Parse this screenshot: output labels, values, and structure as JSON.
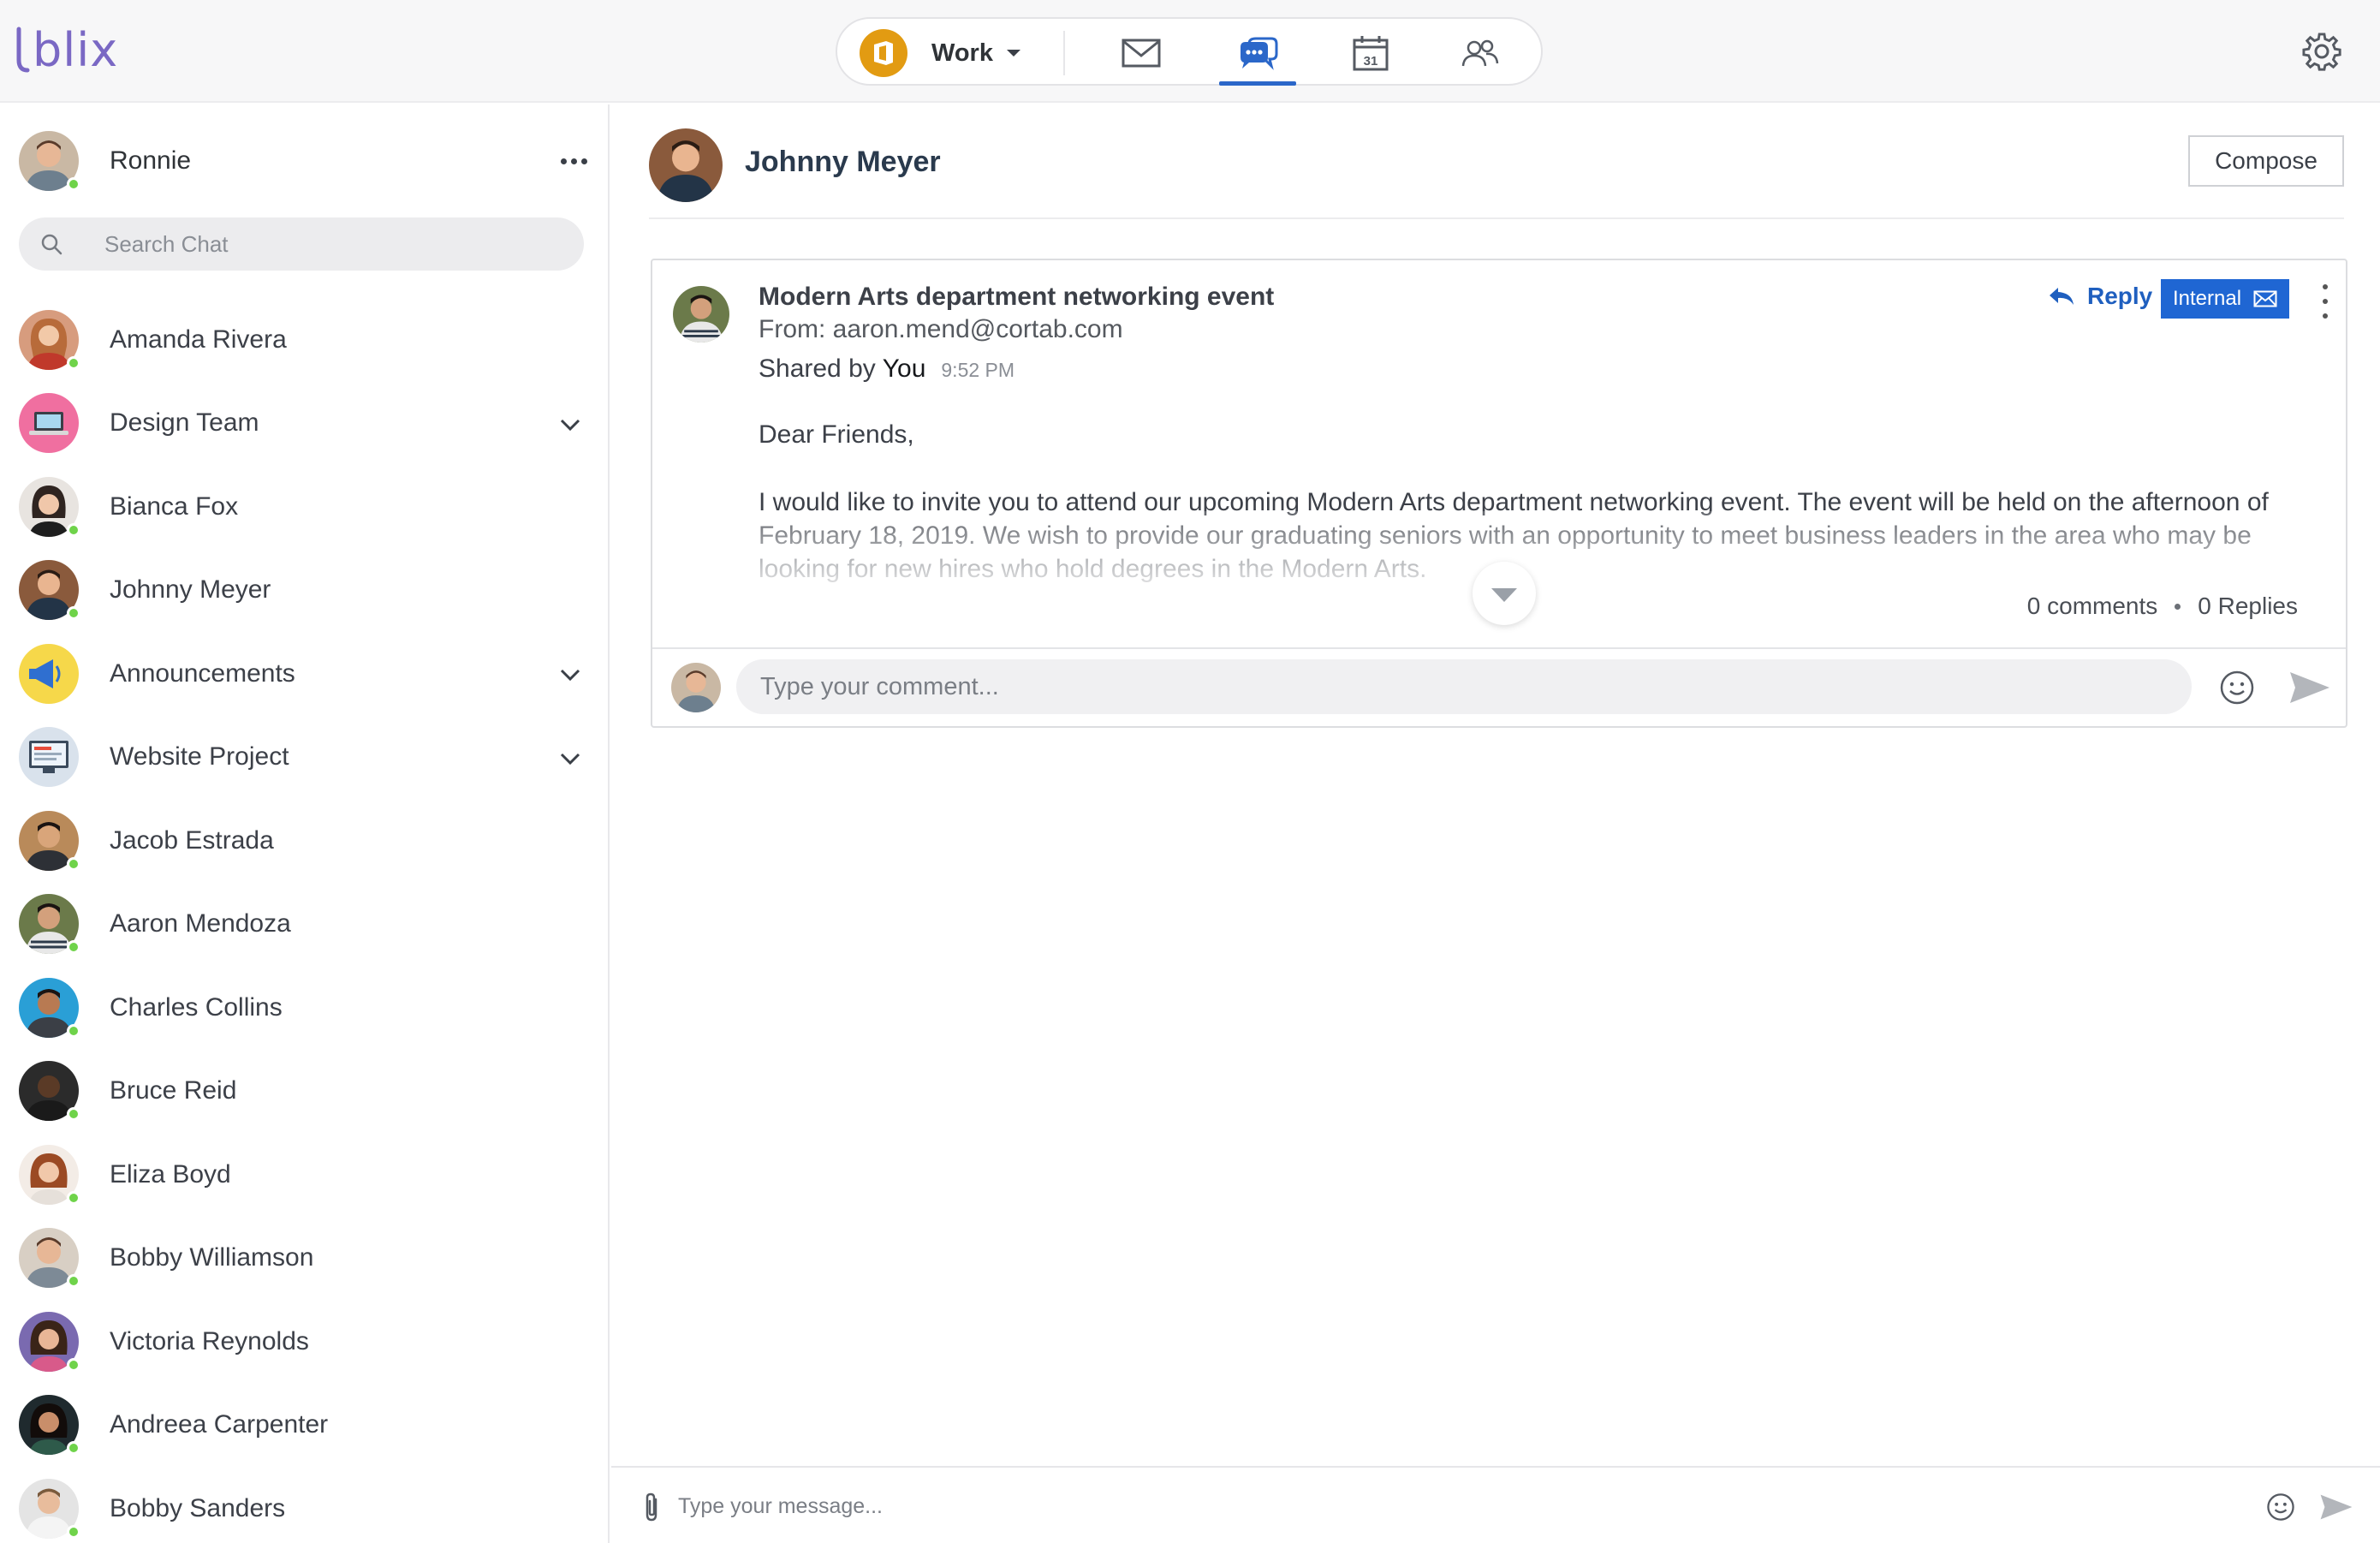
{
  "app": {
    "logo_text": "blix"
  },
  "topbar": {
    "account_label": "Work",
    "account_icon": "office-icon",
    "tabs": [
      {
        "name": "mail",
        "icon": "mail-icon",
        "active": false
      },
      {
        "name": "chat",
        "icon": "chat-icon",
        "active": true
      },
      {
        "name": "calendar",
        "icon": "calendar-icon",
        "day": "31",
        "active": false
      },
      {
        "name": "contacts",
        "icon": "people-icon",
        "active": false
      }
    ],
    "settings_icon": "gear-icon",
    "accent_color": "#2b67c9"
  },
  "sidebar": {
    "me": {
      "name": "Ronnie",
      "online": true
    },
    "search": {
      "placeholder": "Search Chat"
    },
    "contacts": [
      {
        "name": "Amanda Rivera",
        "online": true,
        "expandable": false
      },
      {
        "name": "Design Team",
        "online": false,
        "expandable": true
      },
      {
        "name": "Bianca Fox",
        "online": true,
        "expandable": false
      },
      {
        "name": "Johnny Meyer",
        "online": true,
        "expandable": false
      },
      {
        "name": "Announcements",
        "online": false,
        "expandable": true
      },
      {
        "name": "Website Project",
        "online": false,
        "expandable": true
      },
      {
        "name": "Jacob Estrada",
        "online": true,
        "expandable": false
      },
      {
        "name": "Aaron Mendoza",
        "online": true,
        "expandable": false
      },
      {
        "name": "Charles Collins",
        "online": true,
        "expandable": false
      },
      {
        "name": "Bruce Reid",
        "online": true,
        "expandable": false
      },
      {
        "name": "Eliza Boyd",
        "online": true,
        "expandable": false
      },
      {
        "name": "Bobby Williamson",
        "online": true,
        "expandable": false
      },
      {
        "name": "Victoria Reynolds",
        "online": true,
        "expandable": false
      },
      {
        "name": "Andreea Carpenter",
        "online": true,
        "expandable": false
      },
      {
        "name": "Bobby Sanders",
        "online": true,
        "expandable": false
      }
    ]
  },
  "conversation": {
    "title": "Johnny Meyer",
    "compose_label": "Compose"
  },
  "shared_mail": {
    "subject": "Modern Arts department networking event",
    "from": "From: aaron.mend@cortab.com",
    "shared_by_prefix": "Shared by",
    "shared_by": "You",
    "time": "9:52 PM",
    "reply_label": "Reply",
    "tag_label": "Internal",
    "tag_color": "#1f66d3",
    "greeting": "Dear Friends,",
    "body": "I would like to invite you to attend our upcoming Modern Arts department networking event. The event will be held on the afternoon of February 18, 2019. We wish to provide our graduating seniors with an opportunity to meet business leaders in the area who may be looking for new hires who hold degrees in the Modern Arts.",
    "comments_count": "0 comments",
    "replies_count": "0 Replies",
    "comment_placeholder": "Type your comment..."
  },
  "message_bar": {
    "placeholder": "Type your message..."
  },
  "status_colors": {
    "online": "#6fd34a"
  }
}
